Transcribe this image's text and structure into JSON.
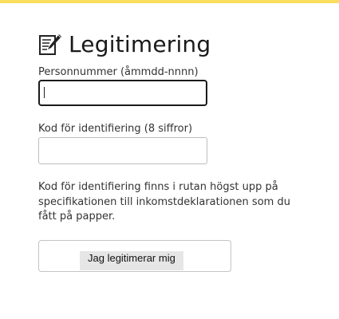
{
  "theme": {
    "accent_bar_color": "#f9dd5b",
    "focus_border_color": "#1a1a1a"
  },
  "header": {
    "icon": "document-pen-icon",
    "title": "Legitimering"
  },
  "form": {
    "personnummer": {
      "label": "Personnummer (åmmdd-nnnn)",
      "value": ""
    },
    "kod": {
      "label": "Kod för identifiering (8 siffror)",
      "value": ""
    },
    "help_text": "Kod för identifiering finns i rutan högst upp på specifikationen till inkomstdeklarationen som du fått på papper.",
    "submit_label": "Jag legitimerar mig"
  }
}
